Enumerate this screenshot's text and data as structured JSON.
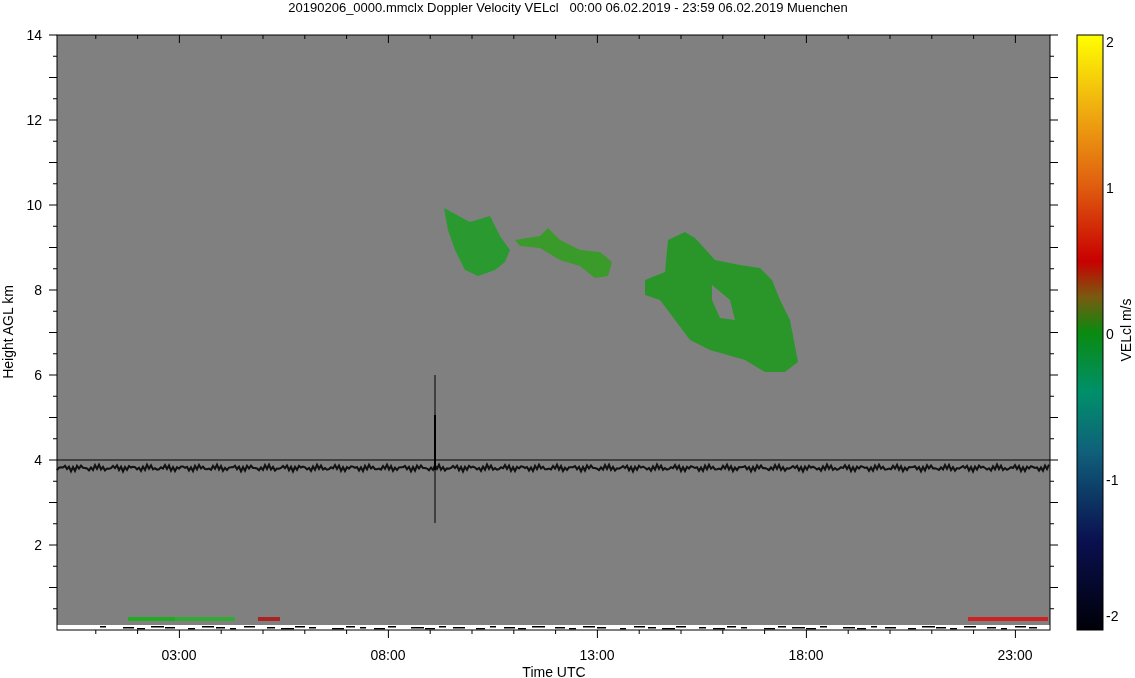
{
  "title": "20190206_0000.mmclx Doppler Velocity VELcl   00:00 06.02.2019 - 23:59 06.02.2019 Muenchen",
  "y_axis": {
    "label": "Height AGL km",
    "ticks": [
      "14",
      "12",
      "10",
      "8",
      "6",
      "4",
      "2"
    ]
  },
  "x_axis": {
    "label": "Time UTC",
    "ticks": [
      "03:00",
      "08:00",
      "13:00",
      "18:00",
      "23:00"
    ]
  },
  "colorbar": {
    "label": "VELcl m/s",
    "ticks": [
      "2",
      "1",
      "0",
      "-1",
      "-2"
    ]
  }
}
